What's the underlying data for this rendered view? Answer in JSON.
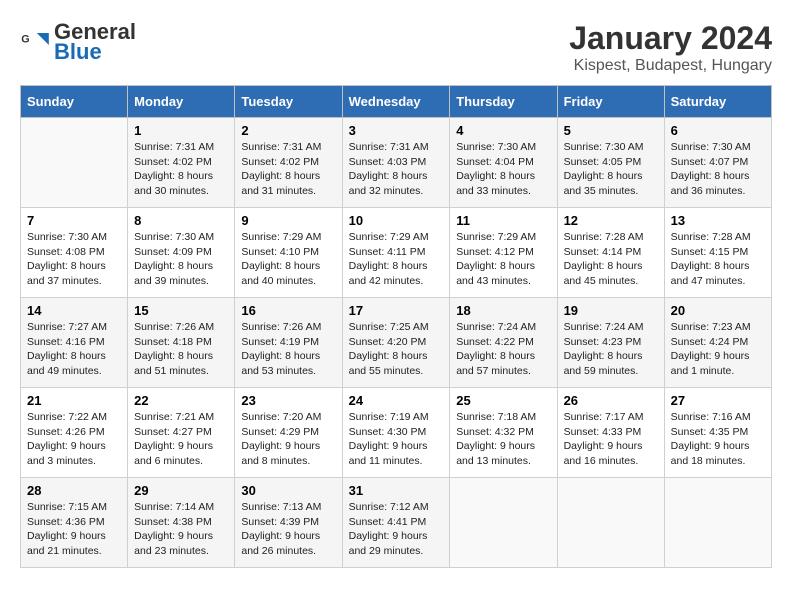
{
  "header": {
    "logo_general": "General",
    "logo_blue": "Blue",
    "title": "January 2024",
    "subtitle": "Kispest, Budapest, Hungary"
  },
  "columns": [
    "Sunday",
    "Monday",
    "Tuesday",
    "Wednesday",
    "Thursday",
    "Friday",
    "Saturday"
  ],
  "weeks": [
    [
      {
        "day": "",
        "info": ""
      },
      {
        "day": "1",
        "info": "Sunrise: 7:31 AM\nSunset: 4:02 PM\nDaylight: 8 hours\nand 30 minutes."
      },
      {
        "day": "2",
        "info": "Sunrise: 7:31 AM\nSunset: 4:02 PM\nDaylight: 8 hours\nand 31 minutes."
      },
      {
        "day": "3",
        "info": "Sunrise: 7:31 AM\nSunset: 4:03 PM\nDaylight: 8 hours\nand 32 minutes."
      },
      {
        "day": "4",
        "info": "Sunrise: 7:30 AM\nSunset: 4:04 PM\nDaylight: 8 hours\nand 33 minutes."
      },
      {
        "day": "5",
        "info": "Sunrise: 7:30 AM\nSunset: 4:05 PM\nDaylight: 8 hours\nand 35 minutes."
      },
      {
        "day": "6",
        "info": "Sunrise: 7:30 AM\nSunset: 4:07 PM\nDaylight: 8 hours\nand 36 minutes."
      }
    ],
    [
      {
        "day": "7",
        "info": "Sunrise: 7:30 AM\nSunset: 4:08 PM\nDaylight: 8 hours\nand 37 minutes."
      },
      {
        "day": "8",
        "info": "Sunrise: 7:30 AM\nSunset: 4:09 PM\nDaylight: 8 hours\nand 39 minutes."
      },
      {
        "day": "9",
        "info": "Sunrise: 7:29 AM\nSunset: 4:10 PM\nDaylight: 8 hours\nand 40 minutes."
      },
      {
        "day": "10",
        "info": "Sunrise: 7:29 AM\nSunset: 4:11 PM\nDaylight: 8 hours\nand 42 minutes."
      },
      {
        "day": "11",
        "info": "Sunrise: 7:29 AM\nSunset: 4:12 PM\nDaylight: 8 hours\nand 43 minutes."
      },
      {
        "day": "12",
        "info": "Sunrise: 7:28 AM\nSunset: 4:14 PM\nDaylight: 8 hours\nand 45 minutes."
      },
      {
        "day": "13",
        "info": "Sunrise: 7:28 AM\nSunset: 4:15 PM\nDaylight: 8 hours\nand 47 minutes."
      }
    ],
    [
      {
        "day": "14",
        "info": "Sunrise: 7:27 AM\nSunset: 4:16 PM\nDaylight: 8 hours\nand 49 minutes."
      },
      {
        "day": "15",
        "info": "Sunrise: 7:26 AM\nSunset: 4:18 PM\nDaylight: 8 hours\nand 51 minutes."
      },
      {
        "day": "16",
        "info": "Sunrise: 7:26 AM\nSunset: 4:19 PM\nDaylight: 8 hours\nand 53 minutes."
      },
      {
        "day": "17",
        "info": "Sunrise: 7:25 AM\nSunset: 4:20 PM\nDaylight: 8 hours\nand 55 minutes."
      },
      {
        "day": "18",
        "info": "Sunrise: 7:24 AM\nSunset: 4:22 PM\nDaylight: 8 hours\nand 57 minutes."
      },
      {
        "day": "19",
        "info": "Sunrise: 7:24 AM\nSunset: 4:23 PM\nDaylight: 8 hours\nand 59 minutes."
      },
      {
        "day": "20",
        "info": "Sunrise: 7:23 AM\nSunset: 4:24 PM\nDaylight: 9 hours\nand 1 minute."
      }
    ],
    [
      {
        "day": "21",
        "info": "Sunrise: 7:22 AM\nSunset: 4:26 PM\nDaylight: 9 hours\nand 3 minutes."
      },
      {
        "day": "22",
        "info": "Sunrise: 7:21 AM\nSunset: 4:27 PM\nDaylight: 9 hours\nand 6 minutes."
      },
      {
        "day": "23",
        "info": "Sunrise: 7:20 AM\nSunset: 4:29 PM\nDaylight: 9 hours\nand 8 minutes."
      },
      {
        "day": "24",
        "info": "Sunrise: 7:19 AM\nSunset: 4:30 PM\nDaylight: 9 hours\nand 11 minutes."
      },
      {
        "day": "25",
        "info": "Sunrise: 7:18 AM\nSunset: 4:32 PM\nDaylight: 9 hours\nand 13 minutes."
      },
      {
        "day": "26",
        "info": "Sunrise: 7:17 AM\nSunset: 4:33 PM\nDaylight: 9 hours\nand 16 minutes."
      },
      {
        "day": "27",
        "info": "Sunrise: 7:16 AM\nSunset: 4:35 PM\nDaylight: 9 hours\nand 18 minutes."
      }
    ],
    [
      {
        "day": "28",
        "info": "Sunrise: 7:15 AM\nSunset: 4:36 PM\nDaylight: 9 hours\nand 21 minutes."
      },
      {
        "day": "29",
        "info": "Sunrise: 7:14 AM\nSunset: 4:38 PM\nDaylight: 9 hours\nand 23 minutes."
      },
      {
        "day": "30",
        "info": "Sunrise: 7:13 AM\nSunset: 4:39 PM\nDaylight: 9 hours\nand 26 minutes."
      },
      {
        "day": "31",
        "info": "Sunrise: 7:12 AM\nSunset: 4:41 PM\nDaylight: 9 hours\nand 29 minutes."
      },
      {
        "day": "",
        "info": ""
      },
      {
        "day": "",
        "info": ""
      },
      {
        "day": "",
        "info": ""
      }
    ]
  ]
}
